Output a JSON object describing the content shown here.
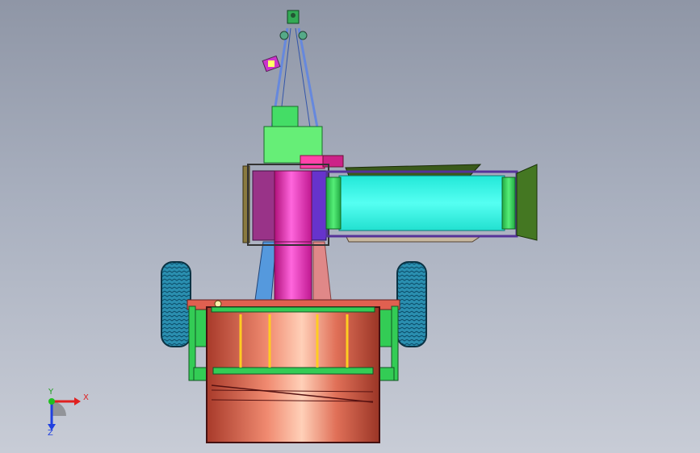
{
  "triad": {
    "x_label": "X",
    "y_label": "Y",
    "z_label": "Z",
    "x_color": "#e02020",
    "y_color": "#20c020",
    "z_color": "#2040e0"
  },
  "colors": {
    "background_top": "#8f96a6",
    "background_bottom": "#c8ccd6",
    "frame_green": "#33cc55",
    "drum_red": "#e06050",
    "shaft_magenta": "#ff33cc",
    "conveyor_cyan": "#33ffee",
    "hopper_dark_green": "#336622",
    "tire_blue": "#33aacc",
    "motor_purple": "#993388",
    "mast_blue": "#6688dd"
  }
}
